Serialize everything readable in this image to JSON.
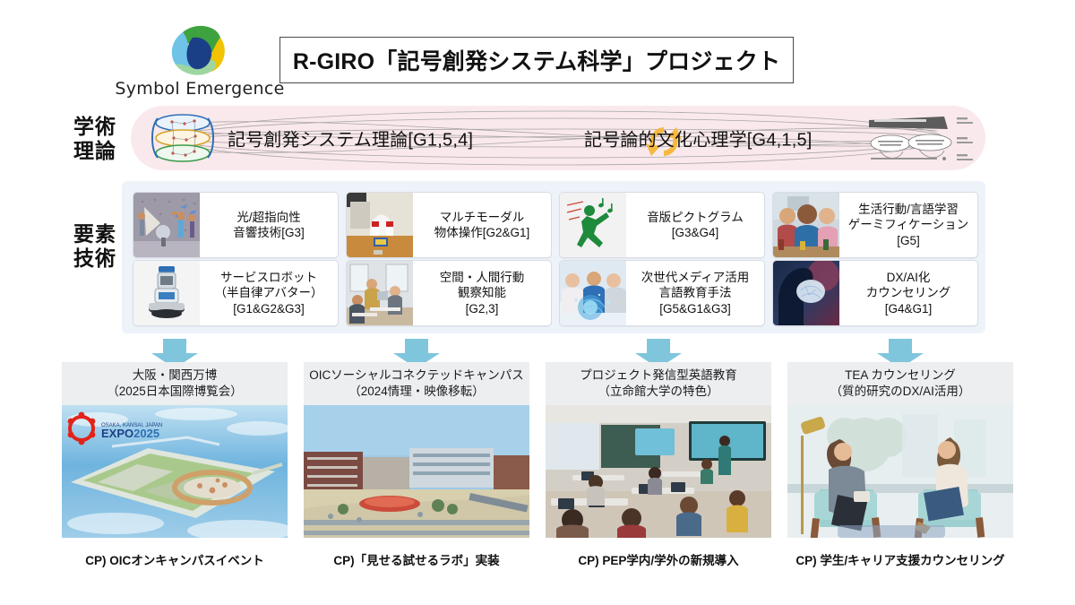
{
  "header": {
    "logo_text": "Symbol Emergence",
    "logo_icon": "symbol-emergence-swirl-logo",
    "title": "R-GIRO「記号創発システム科学」プロジェクト"
  },
  "rows": {
    "theory_label": "学術\n理論",
    "theory_label_line1": "学術",
    "theory_label_line2": "理論",
    "tech_label_line1": "要素",
    "tech_label_line2": "技術"
  },
  "theory": {
    "left_item": "記号創発システム理論[G1,5,4]",
    "right_item": "記号論的文化心理学[G4,1,5]",
    "cycle_icon": "circular-arrows-icon",
    "left_thumb": "layered-emergence-diagram-thumbnail",
    "right_thumb": "semiotic-culture-diagram-thumbnail",
    "band_color": "#fae9ec",
    "cycle_color": "#f5b942"
  },
  "tech": {
    "panel_color": "#eef3fa",
    "items": [
      {
        "label": "光/超指向性\n音響技術[G3]",
        "line1": "光/超指向性",
        "line2": "音響技術[G3]",
        "line3": "",
        "thumb": "directional-audio-room-photo"
      },
      {
        "label": "マルチモーダル\n物体操作[G2&G1]",
        "line1": "マルチモーダル",
        "line2": "物体操作[G2&G1]",
        "line3": "",
        "thumb": "multimodal-manipulation-robot-photo"
      },
      {
        "label": "音版ピクトグラム\n[G3&G4]",
        "line1": "音版ピクトグラム",
        "line2": "[G3&G4]",
        "line3": "",
        "thumb": "running-pictogram-icon"
      },
      {
        "label": "生活行動/言語学習\nゲーミフィケーション\n[G5]",
        "line1": "生活行動/言語学習",
        "line2": "ゲーミフィケーション",
        "line3": "[G5]",
        "thumb": "board-game-players-photo"
      },
      {
        "label": "サービスロボット\n（半自律アバター）\n[G1&G2&G3]",
        "line1": "サービスロボット",
        "line2": "（半自律アバター）",
        "line3": "[G1&G2&G3]",
        "thumb": "service-robot-photo"
      },
      {
        "label": "空間・人間行動\n観察知能\n[G2,3]",
        "line1": "空間・人間行動",
        "line2": "観察知能",
        "line3": "[G2,3]",
        "thumb": "office-observation-photo"
      },
      {
        "label": "次世代メディア活用\n言語教育手法\n[G5&G1&G3]",
        "line1": "次世代メディア活用",
        "line2": "言語教育手法",
        "line3": "[G5&G1&G3]",
        "thumb": "next-gen-media-classroom-photo"
      },
      {
        "label": "DX/AI化\nカウンセリング\n[G4&G1]",
        "line1": "DX/AI化",
        "line2": "カウンセリング",
        "line3": "[G4&G1]",
        "thumb": "ai-brain-profile-photo"
      }
    ]
  },
  "arrow": {
    "color": "#7fc6dd",
    "icon": "down-arrow-icon"
  },
  "cp_columns": [
    {
      "head_line1": "大阪・関西万博",
      "head_line2": "（2025日本国際博覧会）",
      "photo": "expo-2025-site-aerial-render",
      "photo_badge": "EXPO2025",
      "photo_badge_sub": "OSAKA, KANSAI, JAPAN",
      "caption": "CP) OICオンキャンパスイベント"
    },
    {
      "head_line1": "OICソーシャルコネクテッドキャンパス",
      "head_line2": "（2024情理・映像移転）",
      "photo": "oic-campus-exterior-photo",
      "photo_badge": "",
      "photo_badge_sub": "",
      "caption": "CP)「見せる試せるラボ」実装"
    },
    {
      "head_line1": "プロジェクト発信型英語教育",
      "head_line2": "（立命館大学の特色）",
      "photo": "pep-classroom-photo",
      "photo_badge": "",
      "photo_badge_sub": "",
      "caption": "CP) PEP学内/学外の新規導入"
    },
    {
      "head_line1": "TEA カウンセリング",
      "head_line2": "（質的研究のDX/AI活用）",
      "photo": "counseling-session-photo",
      "photo_badge": "",
      "photo_badge_sub": "",
      "caption": "CP) 学生/キャリア支援カウンセリング"
    }
  ]
}
